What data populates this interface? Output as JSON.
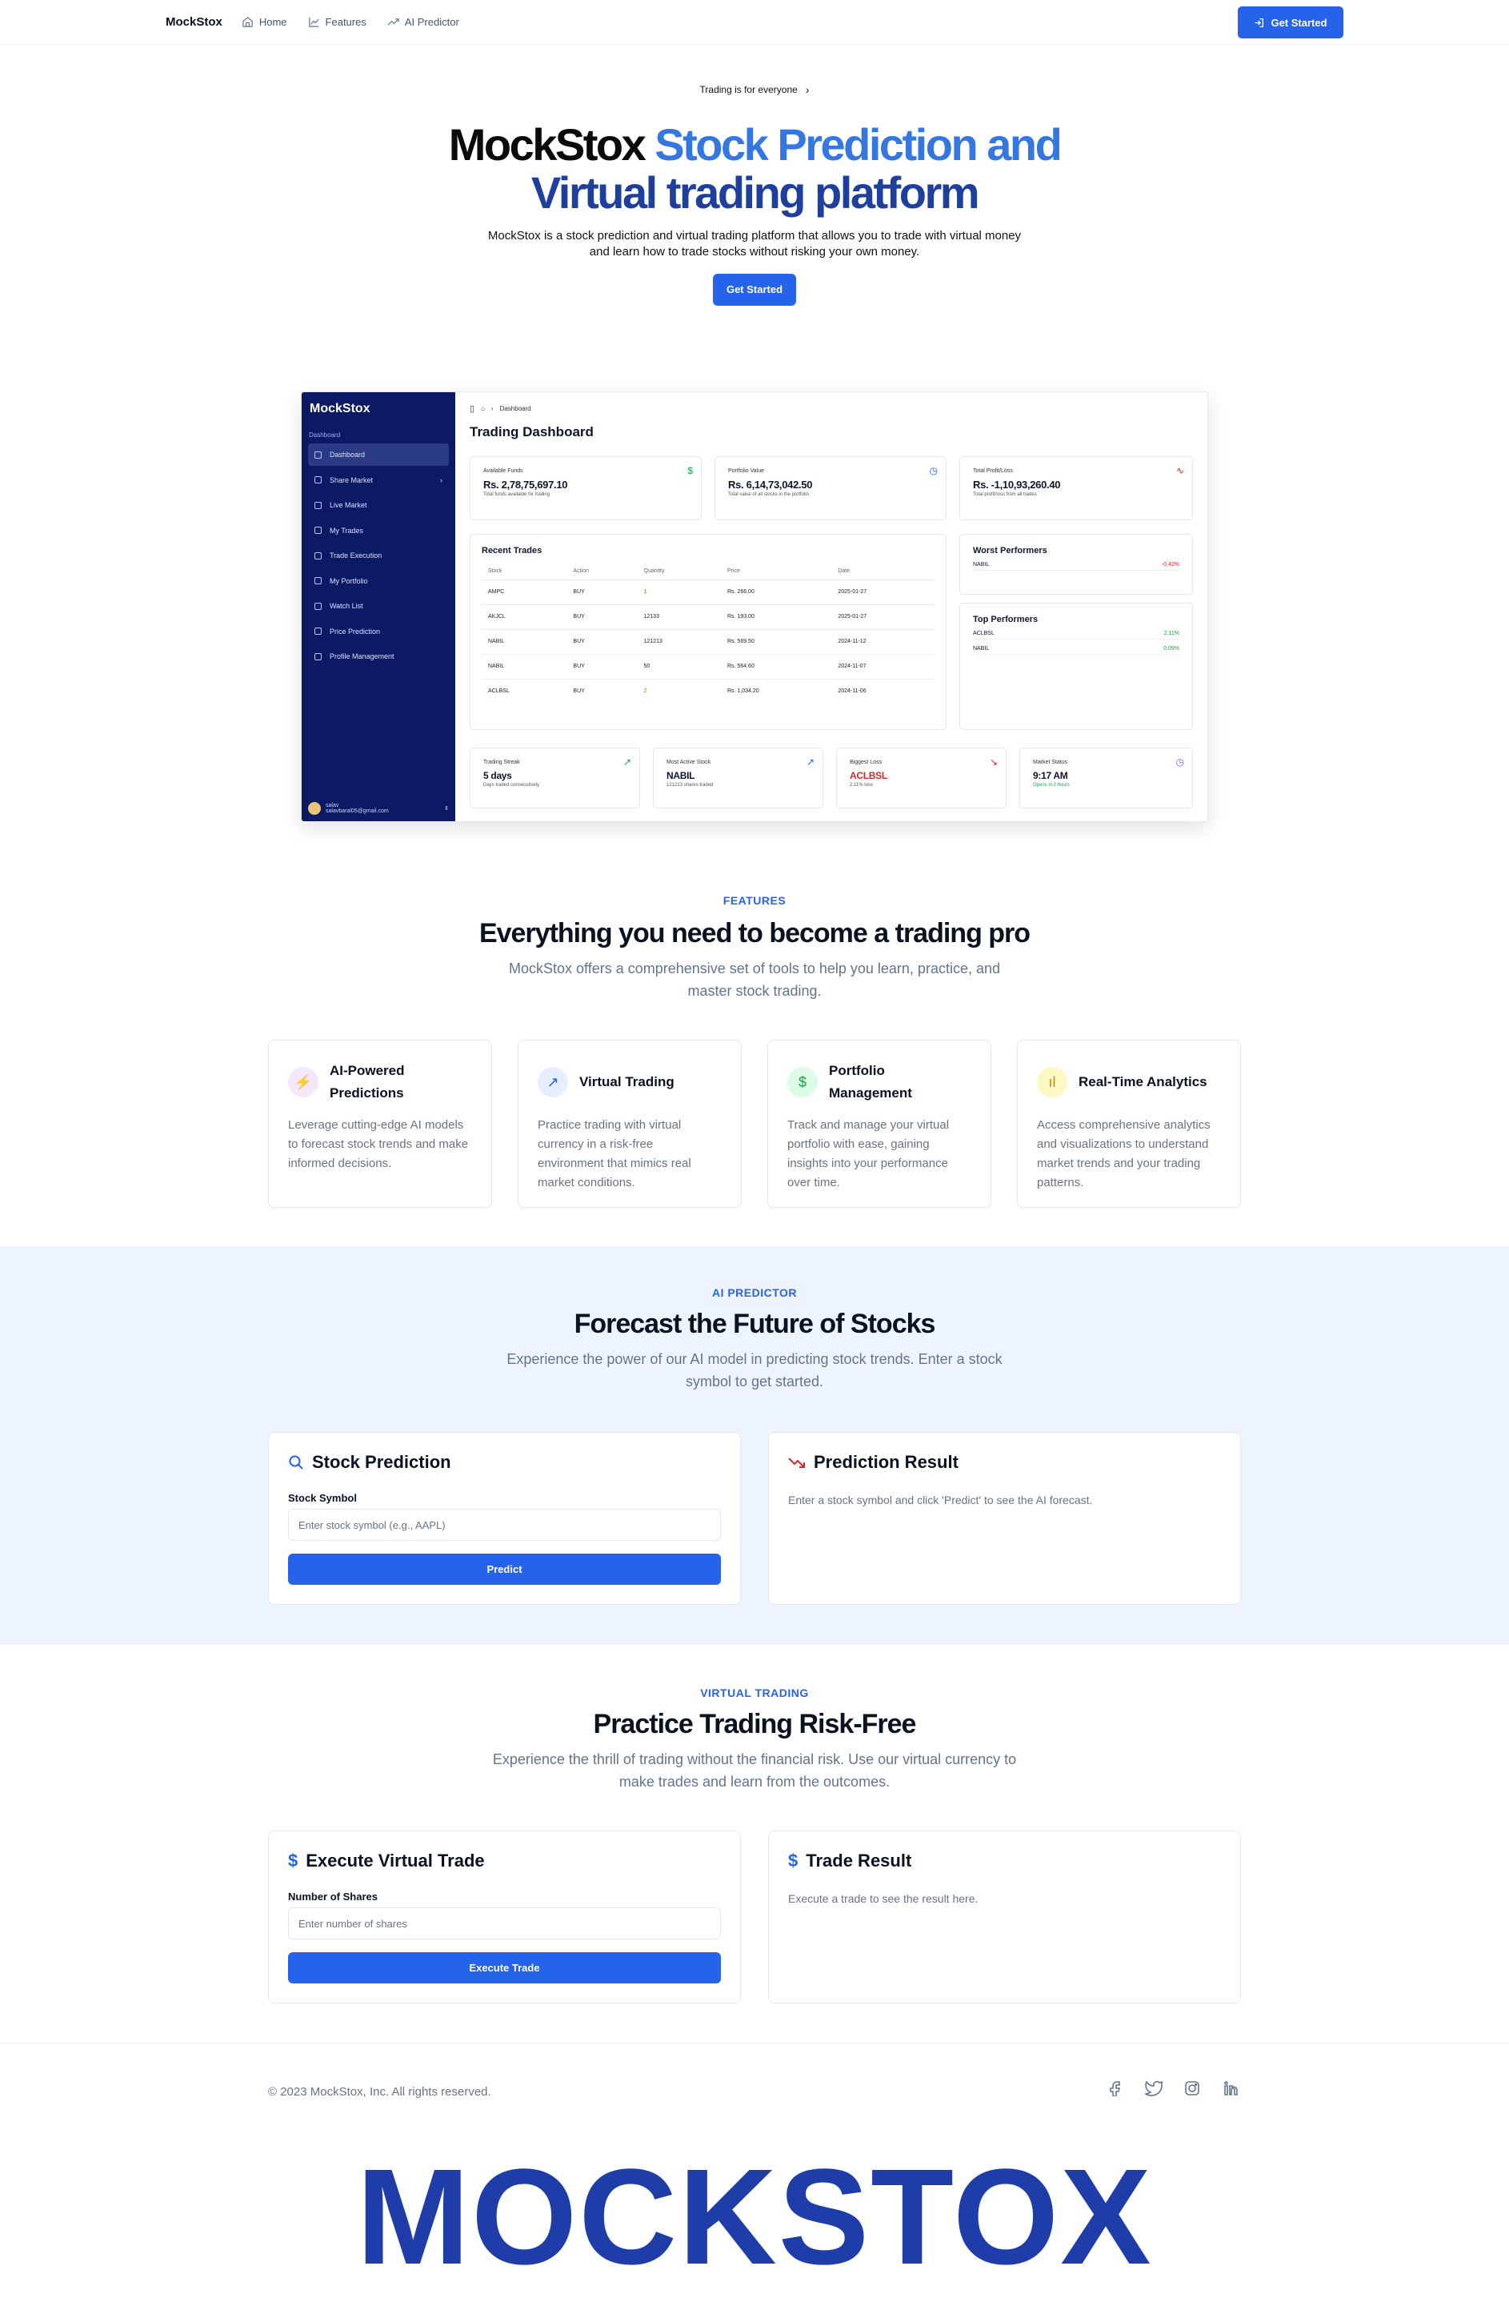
{
  "nav": {
    "brand": "MockStox",
    "links": [
      "Home",
      "Features",
      "AI Predictor"
    ],
    "cta": "Get Started"
  },
  "hero": {
    "pill": "Trading is for everyone",
    "title_part1": "MockStox",
    "title_part2": "Stock Prediction and",
    "title_part3": "Virtual trading platform",
    "description": "MockStox is a stock prediction and virtual trading platform that allows you to trade with virtual money and learn how to trade stocks without risking your own money.",
    "cta": "Get Started"
  },
  "dashboard": {
    "logo": "MockStox",
    "section": "Dashboard",
    "menu": [
      "Dashboard",
      "Share Market",
      "Live Market",
      "My Trades",
      "Trade Execution",
      "My Portfolio",
      "Watch List",
      "Price Prediction",
      "Profile Management"
    ],
    "user_name": "salav",
    "user_email": "salavbaral05@gmail.com",
    "breadcrumb": "Dashboard",
    "title": "Trading Dashboard",
    "stats": [
      {
        "label": "Available Funds",
        "value": "Rs. 2,78,75,697.10",
        "sub": "Total funds available for trading",
        "icon": "$"
      },
      {
        "label": "Portfolio Value",
        "value": "Rs. 6,14,73,042.50",
        "sub": "Total value of all stocks in the portfolio",
        "icon": "◷"
      },
      {
        "label": "Total Profit/Loss",
        "value": "Rs. -1,10,93,260.40",
        "sub": "Total profit/loss from all trades",
        "icon": "∿"
      }
    ],
    "recent_trades_title": "Recent Trades",
    "table_headers": [
      "Stock",
      "Action",
      "Quantity",
      "Price",
      "Date"
    ],
    "trades": [
      [
        "AMPC",
        "BUY",
        "1",
        "Rs. 266.00",
        "2025-01-27"
      ],
      [
        "AKJCL",
        "BUY",
        "12133",
        "Rs. 193.00",
        "2025-01-27"
      ],
      [
        "NABIL",
        "BUY",
        "121213",
        "Rs. 569.50",
        "2024-11-12"
      ],
      [
        "NABIL",
        "BUY",
        "50",
        "Rs. 564.60",
        "2024-11-07"
      ],
      [
        "ACLBSL",
        "BUY",
        "2",
        "Rs. 1,034.20",
        "2024-11-06"
      ]
    ],
    "worst_title": "Worst Performers",
    "worst": [
      {
        "stock": "NABIL",
        "change": "-0.42%"
      }
    ],
    "top_title": "Top Performers",
    "top": [
      {
        "stock": "ACLBSL",
        "change": "2.11%"
      },
      {
        "stock": "NABIL",
        "change": "0.09%"
      }
    ],
    "bottom_stats": [
      {
        "label": "Trading Streak",
        "value": "5 days",
        "sub": "Days traded consecutively",
        "icon": "↗"
      },
      {
        "label": "Most Active Stock",
        "value": "NABIL",
        "sub": "121213 shares traded",
        "icon": "↗"
      },
      {
        "label": "Biggest Loss",
        "value": "ACLBSL",
        "sub": "2.11% loss",
        "icon": "↘"
      },
      {
        "label": "Market Status",
        "value": "9:17 AM",
        "sub": "Opens in 2 hours",
        "icon": "◷"
      }
    ]
  },
  "features": {
    "eyebrow": "FEATURES",
    "title": "Everything you need to become a trading pro",
    "subtitle": "MockStox offers a comprehensive set of tools to help you learn, practice, and master stock trading.",
    "items": [
      {
        "title": "AI-Powered Predictions",
        "desc": "Leverage cutting-edge AI models to forecast stock trends and make informed decisions.",
        "icon": "⚡",
        "color": "#a855f7",
        "bg": "#f3e8ff"
      },
      {
        "title": "Virtual Trading",
        "desc": "Practice trading with virtual currency in a risk-free environment that mimics real market conditions.",
        "icon": "↗",
        "color": "#2563eb",
        "bg": "#e6efff"
      },
      {
        "title": "Portfolio Management",
        "desc": "Track and manage your virtual portfolio with ease, gaining insights into your performance over time.",
        "icon": "$",
        "color": "#16a34a",
        "bg": "#dcfce7"
      },
      {
        "title": "Real-Time Analytics",
        "desc": "Access comprehensive analytics and visualizations to understand market trends and your trading patterns.",
        "icon": "ıl",
        "color": "#ca8a04",
        "bg": "#fef9c3"
      }
    ]
  },
  "predictor": {
    "eyebrow": "AI PREDICTOR",
    "title": "Forecast the Future of Stocks",
    "subtitle": "Experience the power of our AI model in predicting stock trends. Enter a stock symbol to get started.",
    "form_title": "Stock Prediction",
    "field_label": "Stock Symbol",
    "placeholder": "Enter stock symbol (e.g., AAPL)",
    "button": "Predict",
    "result_title": "Prediction Result",
    "result_text": "Enter a stock symbol and click 'Predict' to see the AI forecast."
  },
  "virtual": {
    "eyebrow": "VIRTUAL TRADING",
    "title": "Practice Trading Risk-Free",
    "subtitle": "Experience the thrill of trading without the financial risk. Use our virtual currency to make trades and learn from the outcomes.",
    "form_title": "Execute Virtual Trade",
    "field_label": "Number of Shares",
    "placeholder": "Enter number of shares",
    "button": "Execute Trade",
    "result_title": "Trade Result",
    "result_text": "Execute a trade to see the result here."
  },
  "footer": {
    "copyright": "© 2023 MockStox, Inc. All rights reserved.",
    "socials": [
      "facebook-icon",
      "twitter-icon",
      "instagram-icon",
      "linkedin-icon"
    ],
    "bigword": "MOCKSTOX"
  },
  "colors": {
    "primary": "#2563eb",
    "navy": "#0c1a66",
    "band": "#eef4ff"
  }
}
